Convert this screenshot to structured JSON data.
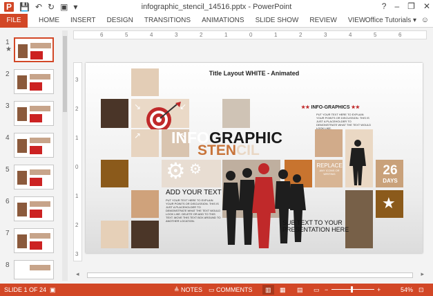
{
  "window": {
    "title": "infographic_stencil_14516.pptx - PowerPoint",
    "help": "?",
    "minimize": "–",
    "restore": "❐",
    "close": "✕"
  },
  "qat": {
    "app_icon": "P",
    "save": "💾",
    "undo": "↶",
    "redo": "↻",
    "present": "▣",
    "more": "▾"
  },
  "ribbon": {
    "file": "FILE",
    "tabs": [
      "HOME",
      "INSERT",
      "DESIGN",
      "TRANSITIONS",
      "ANIMATIONS",
      "SLIDE SHOW",
      "REVIEW",
      "VIEW"
    ],
    "account": "Office Tutorials ▾",
    "smiley": "☺"
  },
  "ruler": {
    "h": [
      "6",
      "5",
      "4",
      "3",
      "2",
      "1",
      "0",
      "1",
      "2",
      "3",
      "4",
      "5",
      "6"
    ],
    "v": [
      "3",
      "2",
      "1",
      "0",
      "1",
      "2",
      "3"
    ]
  },
  "thumbnails": {
    "numbers": [
      "1",
      "2",
      "3",
      "4",
      "5",
      "6",
      "7",
      "8"
    ],
    "star": "★"
  },
  "slide": {
    "title": "Title Layout WHITE - Animated",
    "infog_white": "INFO",
    "infog_dark": "GRAPHIC",
    "stencil_orange": "STEN",
    "stencil_light": "CIL",
    "add_text": "ADD YOUR TEXT",
    "left_para": "PUT YOUR TEXT HERE TO EXPLAIN YOUR POINTS OR DISCUSSION. THIS IS JUST A PLACEHOLDER TO DEMONSTRATE WHAT THE TEXT WOULD LOOK LIKE. DELETE OR ADD TO THIS TEXT. MOVE THIS TEXT BOX AROUND TO ANOTHER LOCATION.",
    "info_heading": "INFO-GRAPHICS",
    "info_stars_left": "★★",
    "info_stars_right": "★★",
    "right_para": "PUT YOUR TEXT HERE TO EXPLAIN YOUR POINTS OR DISCUSSION. THIS IS JUST A PLACEHOLDER TO DEMONSTRATE WHAT THE TEXT WOULD LOOK LIKE.",
    "replace_title": "REPLACE",
    "replace_sub": "ANY ICONS OR WRITING",
    "days_number": "26",
    "days_label": "DAYS",
    "sub_text": "SUB TEXT TO YOUR PRESENTATION HERE",
    "star_icon": "★"
  },
  "status": {
    "slide_of": "SLIDE 1 OF 24",
    "notes": "≜ NOTES",
    "comments": "▭ COMMENTS",
    "zoom_minus": "−",
    "zoom_plus": "+",
    "zoom": "54%"
  },
  "colors": {
    "accent": "#d24726",
    "tile_dark": "#4a3528",
    "tile_brown": "#8b5a2b",
    "tile_tan": "#c9a98b",
    "tile_light": "#e6d5c3",
    "red": "#c0292a"
  }
}
